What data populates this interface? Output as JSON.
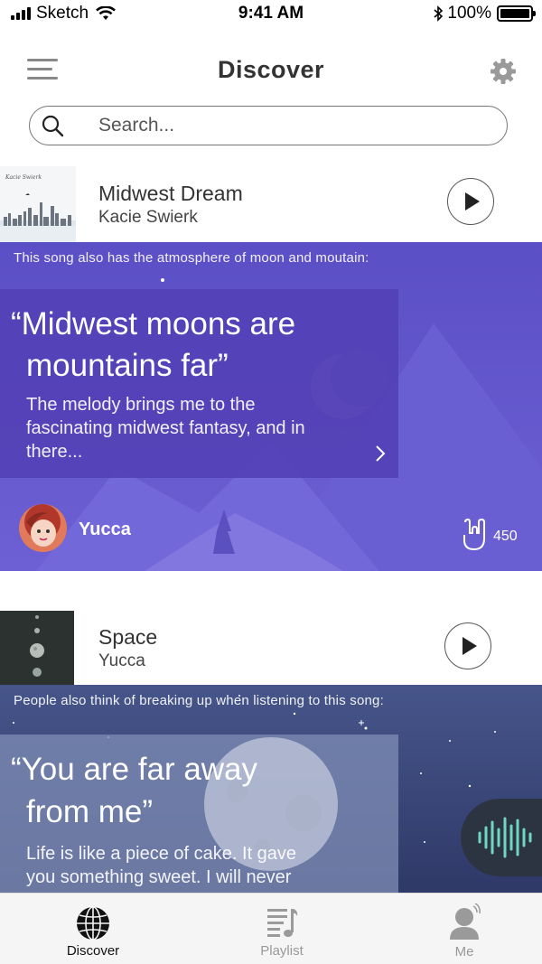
{
  "status_bar": {
    "carrier": "Sketch",
    "time": "9:41 AM",
    "battery": "100%"
  },
  "header": {
    "title": "Discover",
    "menu_icon": "hamburger-menu-icon",
    "settings_icon": "gear-icon"
  },
  "search": {
    "placeholder": "Search..."
  },
  "songs": [
    {
      "title": "Midwest Dream",
      "artist": "Kacie Swierk",
      "note": "This song also has the atmosphere of moon and moutain:",
      "quote_line1": "“Midwest moons are",
      "quote_line2": "mountains far”",
      "desc_line1": "The melody brings me to the",
      "desc_line2": "fascinating midwest fantasy, and in",
      "desc_line3": "there...",
      "user": "Yucca",
      "likes": "450",
      "colors": {
        "card_top": "#5b4fc6",
        "card_bottom": "#6f63d6",
        "quote_box": "#5440b8"
      }
    },
    {
      "title": "Space",
      "artist": "Yucca",
      "note": "People also think of breaking up when listening to this song:",
      "quote_line1": "“You are far away",
      "quote_line2": "from me”",
      "desc_line1": "Life is like a piece of cake. It gave",
      "desc_line2": "you something sweet. I will never",
      "colors": {
        "card_top": "#3f4d7c",
        "card_bottom": "#2c3563"
      }
    }
  ],
  "tab_bar": {
    "tabs": [
      {
        "label": "Discover",
        "icon": "globe-icon",
        "active": true
      },
      {
        "label": "Playlist",
        "icon": "playlist-icon",
        "active": false
      },
      {
        "label": "Me",
        "icon": "profile-icon",
        "active": false
      }
    ]
  }
}
